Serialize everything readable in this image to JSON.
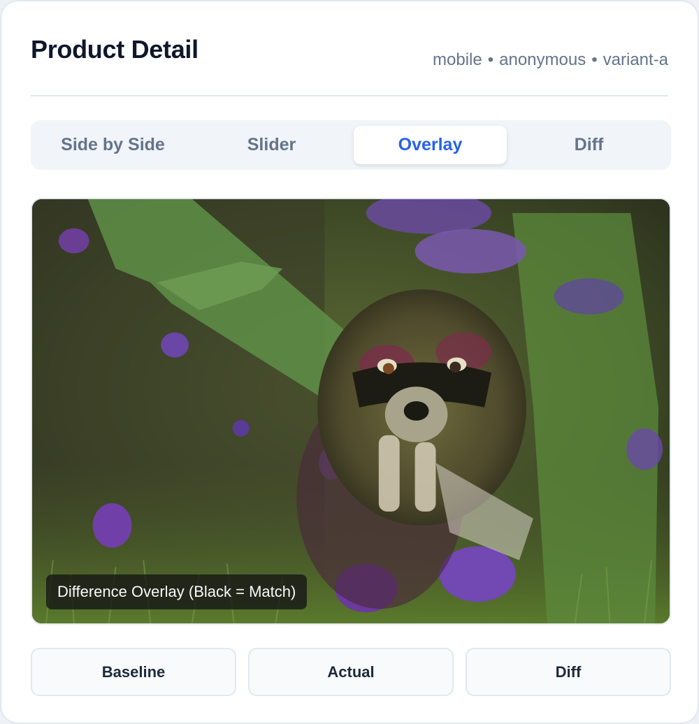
{
  "header": {
    "title": "Product Detail",
    "meta": [
      "mobile",
      "anonymous",
      "variant-a"
    ]
  },
  "tabs": [
    {
      "label": "Side by Side",
      "active": false
    },
    {
      "label": "Slider",
      "active": false
    },
    {
      "label": "Overlay",
      "active": true
    },
    {
      "label": "Diff",
      "active": false
    }
  ],
  "viewer": {
    "caption": "Difference Overlay (Black = Match)"
  },
  "actions": {
    "baseline": "Baseline",
    "actual": "Actual",
    "diff": "Diff"
  },
  "colors": {
    "accent": "#2563eb",
    "muted": "#64748b",
    "border": "#e2e8f0"
  }
}
